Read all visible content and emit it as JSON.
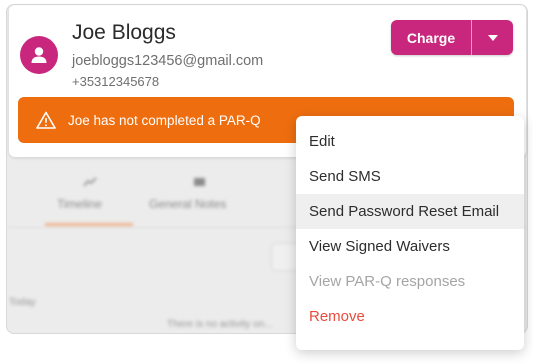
{
  "customer": {
    "name": "Joe Bloggs",
    "email": "joebloggs123456@gmail.com",
    "phone": "+35312345678"
  },
  "charge_button": {
    "label": "Charge"
  },
  "alert": {
    "text": "Joe has not completed a PAR-Q"
  },
  "background_tabs": [
    {
      "label": "Timeline",
      "icon": "chart-line-icon"
    },
    {
      "label": "General Notes",
      "icon": "notes-icon"
    }
  ],
  "background": {
    "today_label": "Today",
    "empty_text": "There is no activity on..."
  },
  "menu": {
    "items": [
      {
        "label": "Edit"
      },
      {
        "label": "Send SMS"
      },
      {
        "label": "Send Password Reset Email"
      },
      {
        "label": "View Signed Waivers"
      },
      {
        "label": "View PAR-Q responses"
      },
      {
        "label": "Remove"
      }
    ]
  },
  "colors": {
    "brand": "#c8277d",
    "warning": "#ee6e0f",
    "danger": "#e84c3d",
    "disabled_text": "#a5a5a5"
  }
}
